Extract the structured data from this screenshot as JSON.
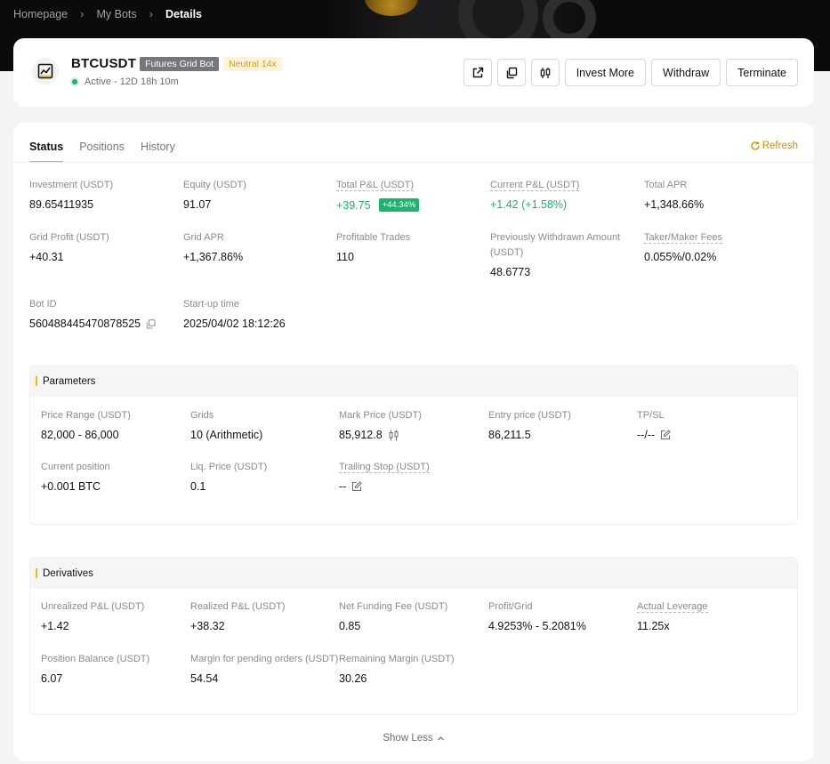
{
  "breadcrumb": {
    "items": [
      "Homepage",
      "My Bots",
      "Details"
    ]
  },
  "header": {
    "symbol": "BTCUSDT",
    "type_tag": "Futures Grid Bot",
    "mode_tag": "Neutral 14x",
    "status": "Active - 12D 18h 10m",
    "buttons": {
      "invest_more": "Invest More",
      "withdraw": "Withdraw",
      "terminate": "Terminate"
    },
    "icons": [
      "share-icon",
      "copy-icon",
      "candlestick-icon"
    ]
  },
  "tabs": {
    "items": [
      "Status",
      "Positions",
      "History"
    ],
    "active": "Status",
    "refresh": "Refresh"
  },
  "status": {
    "investment": {
      "label": "Investment (USDT)",
      "value": "89.65411935"
    },
    "equity": {
      "label": "Equity (USDT)",
      "value": "91.07"
    },
    "total_pnl": {
      "label": "Total P&L (USDT)",
      "value": "+39.75",
      "badge": "+44.34%"
    },
    "current_pnl": {
      "label": "Current P&L (USDT)",
      "value": "+1.42 (+1.58%)"
    },
    "total_apr": {
      "label": "Total APR",
      "value": "+1,348.66%"
    },
    "grid_profit": {
      "label": "Grid Profit (USDT)",
      "value": "+40.31"
    },
    "grid_apr": {
      "label": "Grid APR",
      "value": "+1,367.86%"
    },
    "profitable_trades": {
      "label": "Profitable Trades",
      "value": "110"
    },
    "prev_withdrawn": {
      "label_line1": "Previously Withdrawn Amount",
      "label_line2": "(USDT)",
      "value": "48.6773"
    },
    "fees": {
      "label": "Taker/Maker Fees",
      "value": "0.055%/0.02%"
    },
    "bot_id": {
      "label": "Bot ID",
      "value": "560488445470878525"
    },
    "startup_time": {
      "label": "Start-up time",
      "value": "2025/04/02 18:12:26"
    }
  },
  "parameters": {
    "title": "Parameters",
    "price_range": {
      "label": "Price Range (USDT)",
      "value": "82,000 - 86,000"
    },
    "grids": {
      "label": "Grids",
      "value": "10 (Arithmetic)"
    },
    "mark_price": {
      "label": "Mark Price (USDT)",
      "value": "85,912.8"
    },
    "entry_price": {
      "label": "Entry price (USDT)",
      "value": "86,211.5"
    },
    "tpsl": {
      "label": "TP/SL",
      "value": "--/--"
    },
    "current_position": {
      "label": "Current position",
      "value": "+0.001 BTC"
    },
    "liq_price": {
      "label": "Liq. Price (USDT)",
      "value": "0.1"
    },
    "trailing_stop": {
      "label": "Trailing Stop (USDT)",
      "value": "--"
    }
  },
  "derivatives": {
    "title": "Derivatives",
    "unrealized_pnl": {
      "label": "Unrealized P&L (USDT)",
      "value": "+1.42"
    },
    "realized_pnl": {
      "label": "Realized P&L (USDT)",
      "value": "+38.32"
    },
    "net_funding": {
      "label": "Net Funding Fee (USDT)",
      "value": "0.85"
    },
    "profit_grid": {
      "label": "Profit/Grid",
      "value": "4.9253% - 5.2081%"
    },
    "actual_leverage": {
      "label": "Actual Leverage",
      "value": "11.25x"
    },
    "position_balance": {
      "label": "Position Balance (USDT)",
      "value": "6.07"
    },
    "margin_pending": {
      "label": "Margin for pending orders (USDT)",
      "value": "54.54"
    },
    "remaining_margin": {
      "label": "Remaining Margin (USDT)",
      "value": "30.26"
    }
  },
  "footer": {
    "show_less": "Show Less"
  },
  "colors": {
    "accent": "#f0b90b",
    "profit": "#20b26c",
    "dark_band": "#0b0b0c"
  }
}
